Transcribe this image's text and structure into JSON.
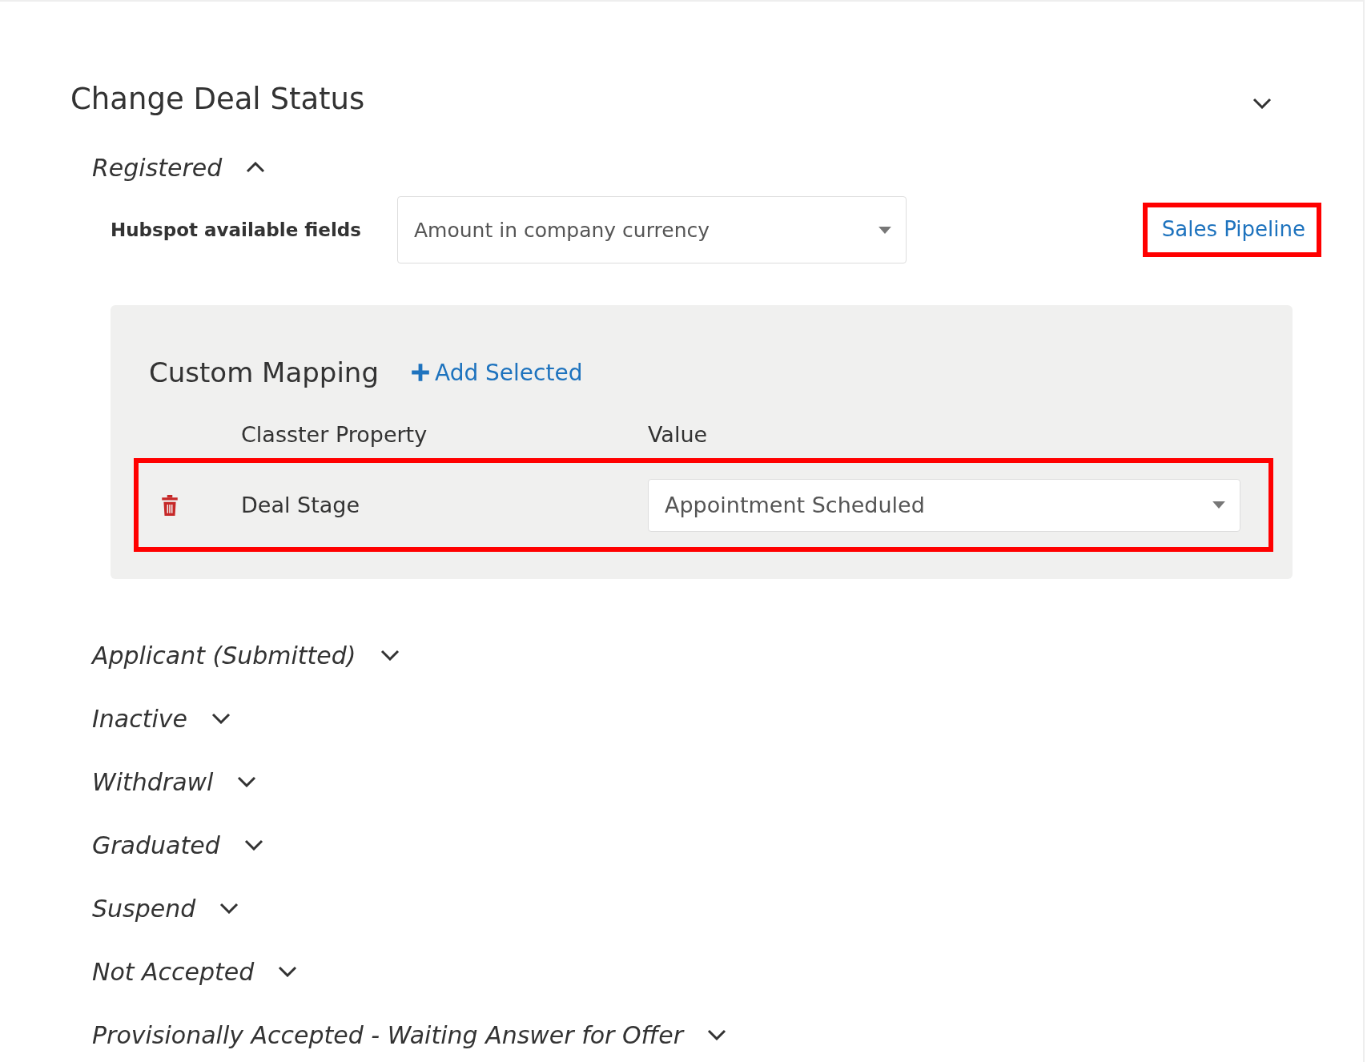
{
  "section": {
    "title": "Change Deal Status"
  },
  "statuses": [
    {
      "label": "Registered",
      "expanded": true,
      "details": {
        "field_label": "Hubspot available fields",
        "field_value": "Amount in company currency",
        "link": {
          "label": "Sales Pipeline",
          "highlighted": true
        },
        "mapping": {
          "title": "Custom Mapping",
          "add_label": "Add Selected",
          "columns": [
            "Classter Property",
            "Value"
          ],
          "rows": [
            {
              "property": "Deal Stage",
              "value": "Appointment Scheduled",
              "highlighted": true
            }
          ]
        }
      }
    },
    {
      "label": "Applicant (Submitted)",
      "expanded": false
    },
    {
      "label": "Inactive",
      "expanded": false
    },
    {
      "label": "Withdrawl",
      "expanded": false
    },
    {
      "label": "Graduated",
      "expanded": false
    },
    {
      "label": "Suspend",
      "expanded": false
    },
    {
      "label": "Not Accepted",
      "expanded": false
    },
    {
      "label": "Provisionally Accepted - Waiting Answer for Offer",
      "expanded": false
    }
  ]
}
